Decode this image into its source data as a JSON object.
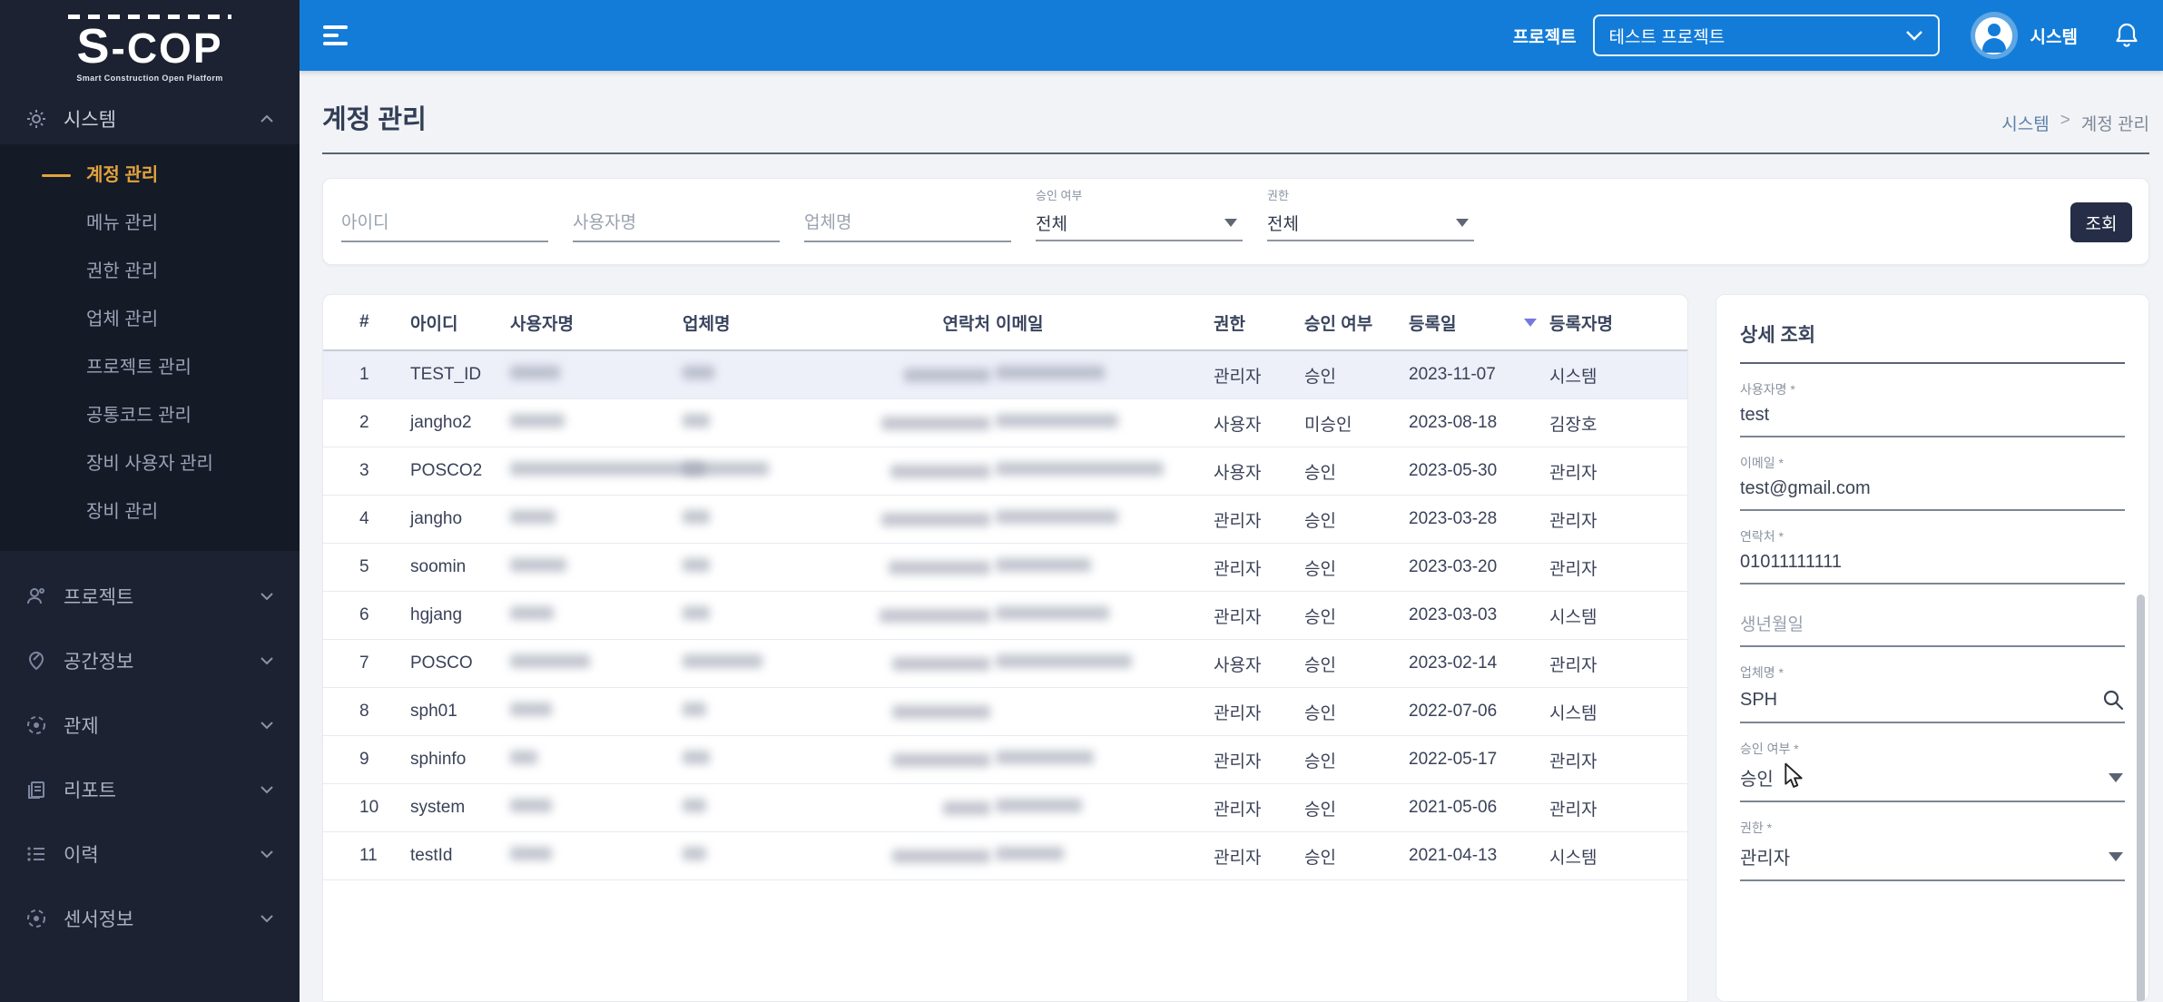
{
  "colors": {
    "header_blue": "#137CD8",
    "sidebar_navy": "#1C2231",
    "submenu_navy": "#151A27",
    "active_menu_orange": "#E2A43C",
    "search_button_navy": "#252E46",
    "selected_row": "#EDEFF9",
    "sort_arrow_purple": "#7579DD",
    "content_bg": "#F1F3F6"
  },
  "sidebar": {
    "logo_title": "S-COP",
    "logo_subtitle": "Smart Construction Open Platform",
    "system_label": "시스템",
    "submenu": [
      "계정 관리",
      "메뉴 관리",
      "권한 관리",
      "업체 관리",
      "프로젝트 관리",
      "공통코드 관리",
      "장비 사용자 관리",
      "장비 관리"
    ],
    "active_submenu": "계정 관리",
    "groups": [
      "프로젝트",
      "공간정보",
      "관제",
      "리포트",
      "이력",
      "센서정보"
    ],
    "group_icons": [
      "users-icon",
      "map-pencil-icon",
      "target-icon",
      "report-icon",
      "list-icon",
      "sensor-icon"
    ]
  },
  "header": {
    "hamburger_icon": "menu-icon",
    "project_label": "프로젝트",
    "project_value": "테스트 프로젝트",
    "user_name": "시스템",
    "icons": [
      "avatar-icon",
      "bell-icon"
    ]
  },
  "page": {
    "title": "계정 관리",
    "breadcrumb_parent": "시스템",
    "breadcrumb_separator": ">",
    "breadcrumb_current": "계정 관리"
  },
  "filters": {
    "id_placeholder": "아이디",
    "username_placeholder": "사용자명",
    "company_placeholder": "업체명",
    "approval_label": "승인 여부",
    "approval_value": "전체",
    "role_label": "권한",
    "role_value": "전체",
    "search_button": "조회"
  },
  "table": {
    "columns": [
      "#",
      "아이디",
      "사용자명",
      "업체명",
      "연락처",
      "이메일",
      "권한",
      "승인 여부",
      "등록일",
      "등록자명"
    ],
    "sorted_column": "등록일",
    "redacted_columns": [
      "사용자명",
      "업체명",
      "연락처",
      "이메일"
    ],
    "rows": [
      {
        "no": "1",
        "id": "TEST_ID",
        "role": "관리자",
        "approval": "승인",
        "date": "2023-11-07",
        "registrar": "시스템",
        "selected": true,
        "blur": {
          "name": 55,
          "company": 35,
          "phone": 95,
          "email": 120
        }
      },
      {
        "no": "2",
        "id": "jangho2",
        "role": "사용자",
        "approval": "미승인",
        "date": "2023-08-18",
        "registrar": "김장호",
        "selected": false,
        "blur": {
          "name": 60,
          "company": 30,
          "phone": 120,
          "email": 135
        }
      },
      {
        "no": "3",
        "id": "POSCO2",
        "role": "사용자",
        "approval": "승인",
        "date": "2023-05-30",
        "registrar": "관리자",
        "selected": false,
        "blur": {
          "name": 215,
          "company": 95,
          "phone": 110,
          "email": 185
        }
      },
      {
        "no": "4",
        "id": "jangho",
        "role": "관리자",
        "approval": "승인",
        "date": "2023-03-28",
        "registrar": "관리자",
        "selected": false,
        "blur": {
          "name": 50,
          "company": 30,
          "phone": 120,
          "email": 135
        }
      },
      {
        "no": "5",
        "id": "soomin",
        "role": "관리자",
        "approval": "승인",
        "date": "2023-03-20",
        "registrar": "관리자",
        "selected": false,
        "blur": {
          "name": 62,
          "company": 30,
          "phone": 112,
          "email": 105
        }
      },
      {
        "no": "6",
        "id": "hgjang",
        "role": "관리자",
        "approval": "승인",
        "date": "2023-03-03",
        "registrar": "시스템",
        "selected": false,
        "blur": {
          "name": 48,
          "company": 30,
          "phone": 122,
          "email": 125
        }
      },
      {
        "no": "7",
        "id": "POSCO",
        "role": "사용자",
        "approval": "승인",
        "date": "2023-02-14",
        "registrar": "관리자",
        "selected": false,
        "blur": {
          "name": 88,
          "company": 88,
          "phone": 108,
          "email": 150
        }
      },
      {
        "no": "8",
        "id": "sph01",
        "role": "관리자",
        "approval": "승인",
        "date": "2022-07-06",
        "registrar": "시스템",
        "selected": false,
        "blur": {
          "name": 46,
          "company": 26,
          "phone": 108,
          "email": 0
        }
      },
      {
        "no": "9",
        "id": "sphinfo",
        "role": "관리자",
        "approval": "승인",
        "date": "2022-05-17",
        "registrar": "관리자",
        "selected": false,
        "blur": {
          "name": 30,
          "company": 30,
          "phone": 108,
          "email": 108
        }
      },
      {
        "no": "10",
        "id": "system",
        "role": "관리자",
        "approval": "승인",
        "date": "2021-05-06",
        "registrar": "관리자",
        "selected": false,
        "blur": {
          "name": 46,
          "company": 26,
          "phone": 52,
          "email": 95
        }
      },
      {
        "no": "11",
        "id": "testId",
        "role": "관리자",
        "approval": "승인",
        "date": "2021-04-13",
        "registrar": "시스템",
        "selected": false,
        "blur": {
          "name": 46,
          "company": 26,
          "phone": 108,
          "email": 75
        }
      }
    ]
  },
  "detail": {
    "title": "상세 조회",
    "fields": [
      {
        "label": "사용자명 *",
        "value": "test"
      },
      {
        "label": "이메일 *",
        "value": "test@gmail.com"
      },
      {
        "label": "연락처 *",
        "value": "01011111111"
      },
      {
        "label": "생년월일",
        "value": ""
      },
      {
        "label": "업체명 *",
        "value": "SPH",
        "icon": "search-icon"
      },
      {
        "label": "승인 여부 *",
        "value": "승인",
        "icon": "dropdown-icon"
      },
      {
        "label": "권한 *",
        "value": "관리자",
        "icon": "dropdown-icon"
      }
    ]
  }
}
